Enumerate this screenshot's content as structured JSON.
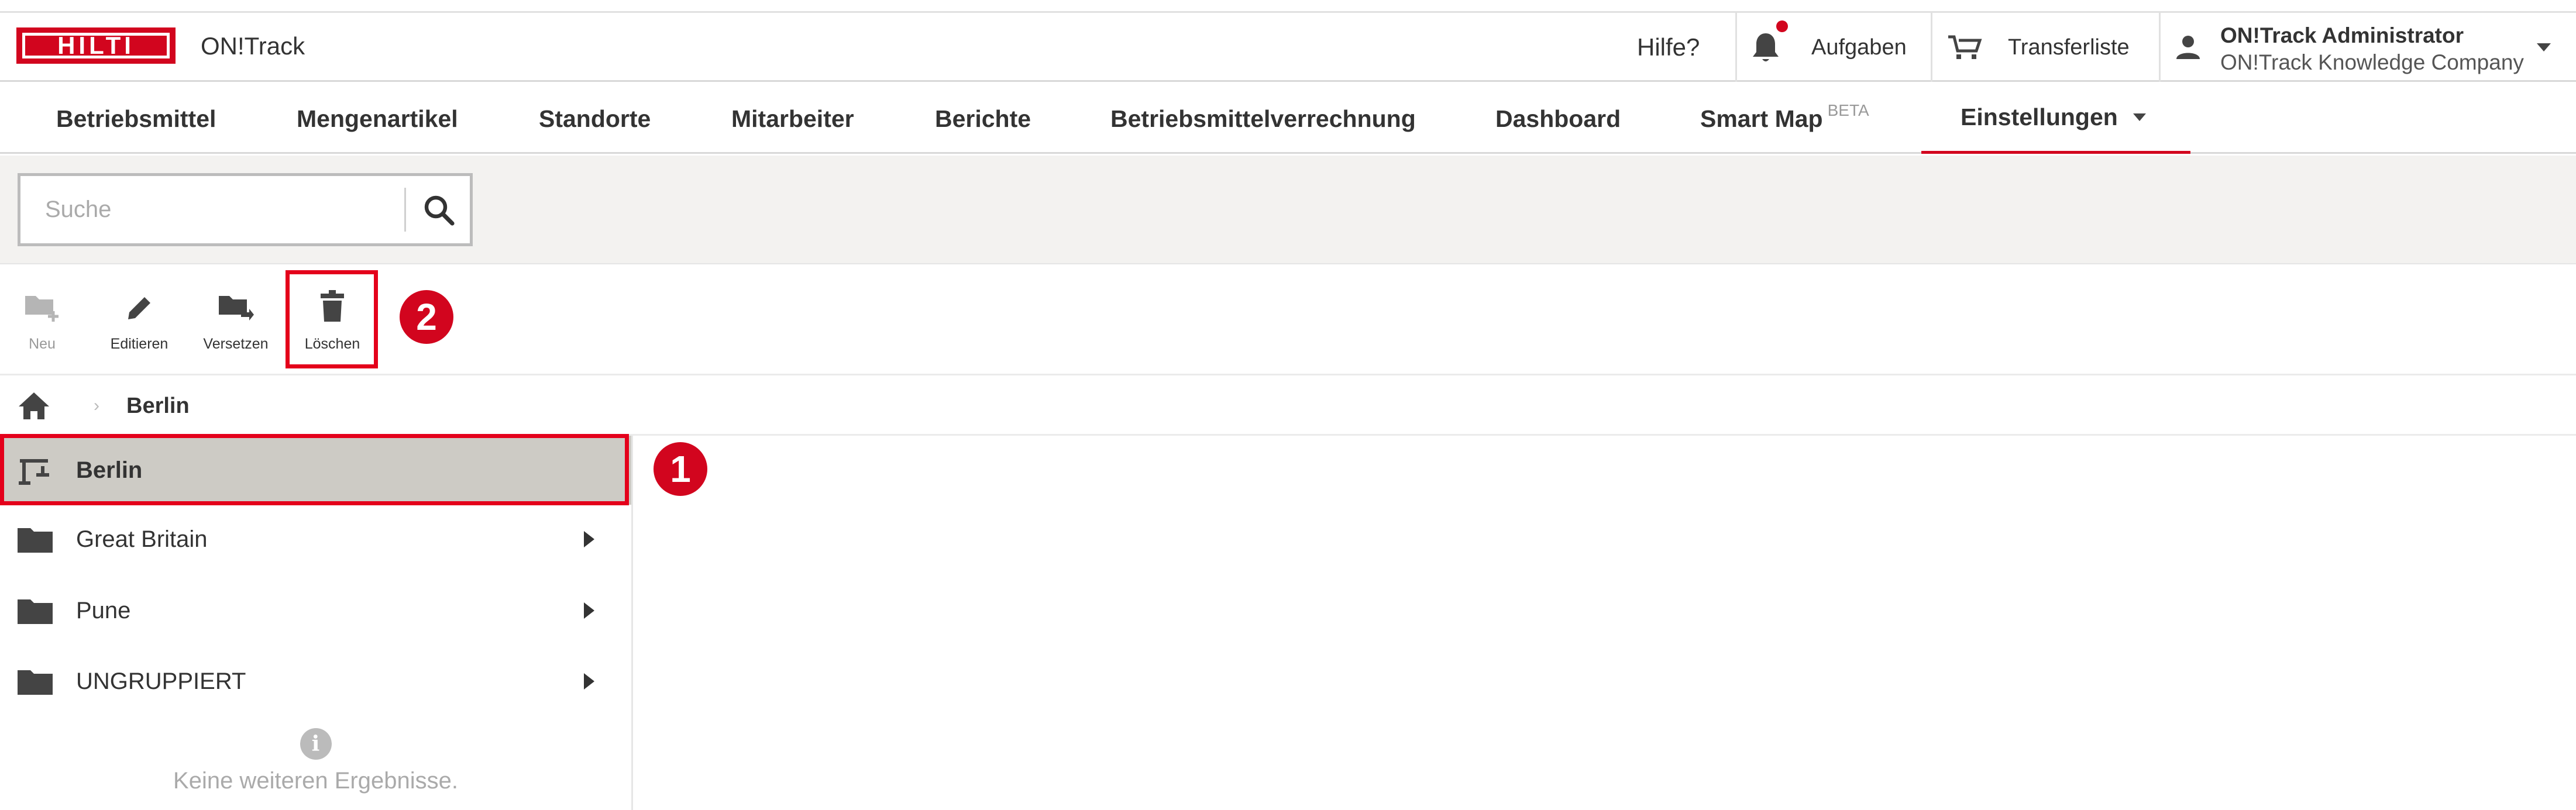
{
  "app": {
    "logo_text": "HILTI",
    "title": "ON!Track"
  },
  "header": {
    "help_label": "Hilfe?",
    "tasks_label": "Aufgaben",
    "transfer_label": "Transferliste",
    "user_name": "ON!Track Administrator",
    "user_company": "ON!Track Knowledge Company"
  },
  "nav": {
    "items": [
      {
        "label": "Betriebsmittel"
      },
      {
        "label": "Mengenartikel"
      },
      {
        "label": "Standorte"
      },
      {
        "label": "Mitarbeiter"
      },
      {
        "label": "Berichte"
      },
      {
        "label": "Betriebsmittelverrechnung"
      },
      {
        "label": "Dashboard"
      },
      {
        "label": "Smart Map",
        "badge": "BETA"
      },
      {
        "label": "Einstellungen"
      }
    ]
  },
  "search": {
    "placeholder": "Suche",
    "value": ""
  },
  "toolbar": {
    "new_label": "Neu",
    "edit_label": "Editieren",
    "move_label": "Versetzen",
    "delete_label": "Löschen"
  },
  "annotations": {
    "step1": "1",
    "step2": "2"
  },
  "breadcrumb": {
    "current": "Berlin"
  },
  "tree": {
    "items": [
      {
        "label": "Berlin",
        "icon": "construction-site-icon",
        "selected": true
      },
      {
        "label": "Great Britain",
        "icon": "folder-icon"
      },
      {
        "label": "Pune",
        "icon": "folder-icon"
      },
      {
        "label": "UNGRUPPIERT",
        "icon": "folder-icon"
      }
    ],
    "no_more_results": "Keine weiteren Ergebnisse."
  },
  "colors": {
    "brand_red": "#d2051e",
    "selected_row": "#cdcbc5",
    "search_bg": "#f3f2f0"
  }
}
